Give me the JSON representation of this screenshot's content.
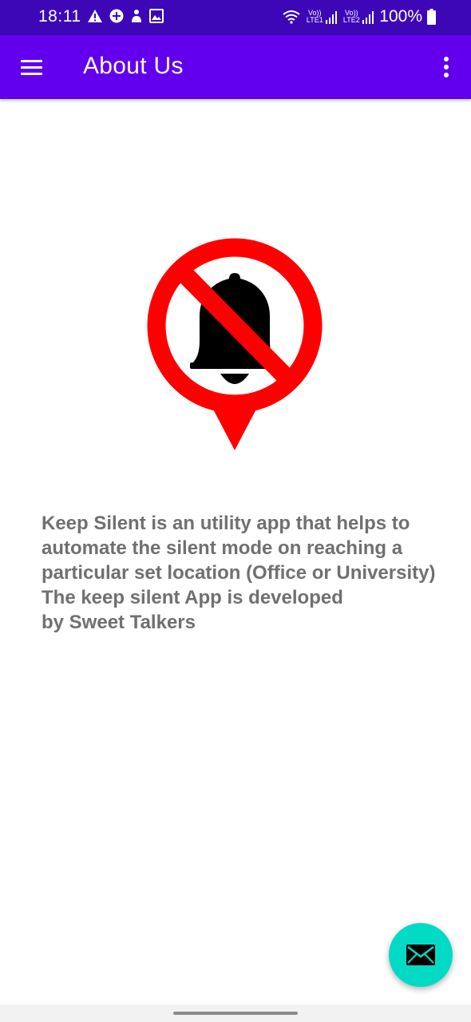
{
  "status_bar": {
    "time": "18:11",
    "battery_percent": "100%",
    "sim1_label": "Vo)) LTE1",
    "sim2_label": "Vo)) LTE2",
    "icons": [
      "warning-icon",
      "circle-badge-icon",
      "person-icon",
      "image-icon",
      "wifi-icon",
      "signal-icon",
      "signal-icon",
      "battery-icon"
    ]
  },
  "app_bar": {
    "title": "About Us",
    "menu_icon": "hamburger-menu-icon",
    "overflow_icon": "more-vert-icon",
    "background_color": "#6200ee"
  },
  "logo": {
    "icon": "no-bell-location-pin-icon",
    "ring_color": "#ff0000",
    "bell_color": "#000000"
  },
  "about": {
    "lines": [
      "Keep Silent is an utility app that helps to",
      "automate the silent mode on reaching a",
      "particular set location (Office or University)",
      "The keep silent App is developed",
      "by Sweet Talkers"
    ],
    "text_color": "#707070"
  },
  "fab": {
    "icon": "email-icon",
    "color": "#03dac5"
  }
}
